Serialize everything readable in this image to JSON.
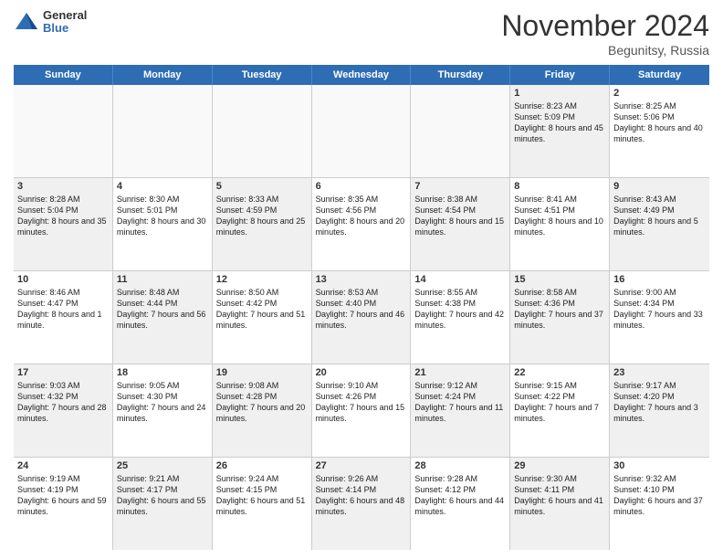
{
  "logo": {
    "general": "General",
    "blue": "Blue"
  },
  "title": "November 2024",
  "location": "Begunitsy, Russia",
  "days_header": [
    "Sunday",
    "Monday",
    "Tuesday",
    "Wednesday",
    "Thursday",
    "Friday",
    "Saturday"
  ],
  "weeks": [
    [
      {
        "day": "",
        "info": "",
        "empty": true
      },
      {
        "day": "",
        "info": "",
        "empty": true
      },
      {
        "day": "",
        "info": "",
        "empty": true
      },
      {
        "day": "",
        "info": "",
        "empty": true
      },
      {
        "day": "",
        "info": "",
        "empty": true
      },
      {
        "day": "1",
        "info": "Sunrise: 8:23 AM\nSunset: 5:09 PM\nDaylight: 8 hours and 45 minutes.",
        "shaded": true
      },
      {
        "day": "2",
        "info": "Sunrise: 8:25 AM\nSunset: 5:06 PM\nDaylight: 8 hours and 40 minutes.",
        "shaded": false
      }
    ],
    [
      {
        "day": "3",
        "info": "Sunrise: 8:28 AM\nSunset: 5:04 PM\nDaylight: 8 hours and 35 minutes.",
        "shaded": true
      },
      {
        "day": "4",
        "info": "Sunrise: 8:30 AM\nSunset: 5:01 PM\nDaylight: 8 hours and 30 minutes.",
        "shaded": false
      },
      {
        "day": "5",
        "info": "Sunrise: 8:33 AM\nSunset: 4:59 PM\nDaylight: 8 hours and 25 minutes.",
        "shaded": true
      },
      {
        "day": "6",
        "info": "Sunrise: 8:35 AM\nSunset: 4:56 PM\nDaylight: 8 hours and 20 minutes.",
        "shaded": false
      },
      {
        "day": "7",
        "info": "Sunrise: 8:38 AM\nSunset: 4:54 PM\nDaylight: 8 hours and 15 minutes.",
        "shaded": true
      },
      {
        "day": "8",
        "info": "Sunrise: 8:41 AM\nSunset: 4:51 PM\nDaylight: 8 hours and 10 minutes.",
        "shaded": false
      },
      {
        "day": "9",
        "info": "Sunrise: 8:43 AM\nSunset: 4:49 PM\nDaylight: 8 hours and 5 minutes.",
        "shaded": true
      }
    ],
    [
      {
        "day": "10",
        "info": "Sunrise: 8:46 AM\nSunset: 4:47 PM\nDaylight: 8 hours and 1 minute.",
        "shaded": false
      },
      {
        "day": "11",
        "info": "Sunrise: 8:48 AM\nSunset: 4:44 PM\nDaylight: 7 hours and 56 minutes.",
        "shaded": true
      },
      {
        "day": "12",
        "info": "Sunrise: 8:50 AM\nSunset: 4:42 PM\nDaylight: 7 hours and 51 minutes.",
        "shaded": false
      },
      {
        "day": "13",
        "info": "Sunrise: 8:53 AM\nSunset: 4:40 PM\nDaylight: 7 hours and 46 minutes.",
        "shaded": true
      },
      {
        "day": "14",
        "info": "Sunrise: 8:55 AM\nSunset: 4:38 PM\nDaylight: 7 hours and 42 minutes.",
        "shaded": false
      },
      {
        "day": "15",
        "info": "Sunrise: 8:58 AM\nSunset: 4:36 PM\nDaylight: 7 hours and 37 minutes.",
        "shaded": true
      },
      {
        "day": "16",
        "info": "Sunrise: 9:00 AM\nSunset: 4:34 PM\nDaylight: 7 hours and 33 minutes.",
        "shaded": false
      }
    ],
    [
      {
        "day": "17",
        "info": "Sunrise: 9:03 AM\nSunset: 4:32 PM\nDaylight: 7 hours and 28 minutes.",
        "shaded": true
      },
      {
        "day": "18",
        "info": "Sunrise: 9:05 AM\nSunset: 4:30 PM\nDaylight: 7 hours and 24 minutes.",
        "shaded": false
      },
      {
        "day": "19",
        "info": "Sunrise: 9:08 AM\nSunset: 4:28 PM\nDaylight: 7 hours and 20 minutes.",
        "shaded": true
      },
      {
        "day": "20",
        "info": "Sunrise: 9:10 AM\nSunset: 4:26 PM\nDaylight: 7 hours and 15 minutes.",
        "shaded": false
      },
      {
        "day": "21",
        "info": "Sunrise: 9:12 AM\nSunset: 4:24 PM\nDaylight: 7 hours and 11 minutes.",
        "shaded": true
      },
      {
        "day": "22",
        "info": "Sunrise: 9:15 AM\nSunset: 4:22 PM\nDaylight: 7 hours and 7 minutes.",
        "shaded": false
      },
      {
        "day": "23",
        "info": "Sunrise: 9:17 AM\nSunset: 4:20 PM\nDaylight: 7 hours and 3 minutes.",
        "shaded": true
      }
    ],
    [
      {
        "day": "24",
        "info": "Sunrise: 9:19 AM\nSunset: 4:19 PM\nDaylight: 6 hours and 59 minutes.",
        "shaded": false
      },
      {
        "day": "25",
        "info": "Sunrise: 9:21 AM\nSunset: 4:17 PM\nDaylight: 6 hours and 55 minutes.",
        "shaded": true
      },
      {
        "day": "26",
        "info": "Sunrise: 9:24 AM\nSunset: 4:15 PM\nDaylight: 6 hours and 51 minutes.",
        "shaded": false
      },
      {
        "day": "27",
        "info": "Sunrise: 9:26 AM\nSunset: 4:14 PM\nDaylight: 6 hours and 48 minutes.",
        "shaded": true
      },
      {
        "day": "28",
        "info": "Sunrise: 9:28 AM\nSunset: 4:12 PM\nDaylight: 6 hours and 44 minutes.",
        "shaded": false
      },
      {
        "day": "29",
        "info": "Sunrise: 9:30 AM\nSunset: 4:11 PM\nDaylight: 6 hours and 41 minutes.",
        "shaded": true
      },
      {
        "day": "30",
        "info": "Sunrise: 9:32 AM\nSunset: 4:10 PM\nDaylight: 6 hours and 37 minutes.",
        "shaded": false
      }
    ]
  ]
}
